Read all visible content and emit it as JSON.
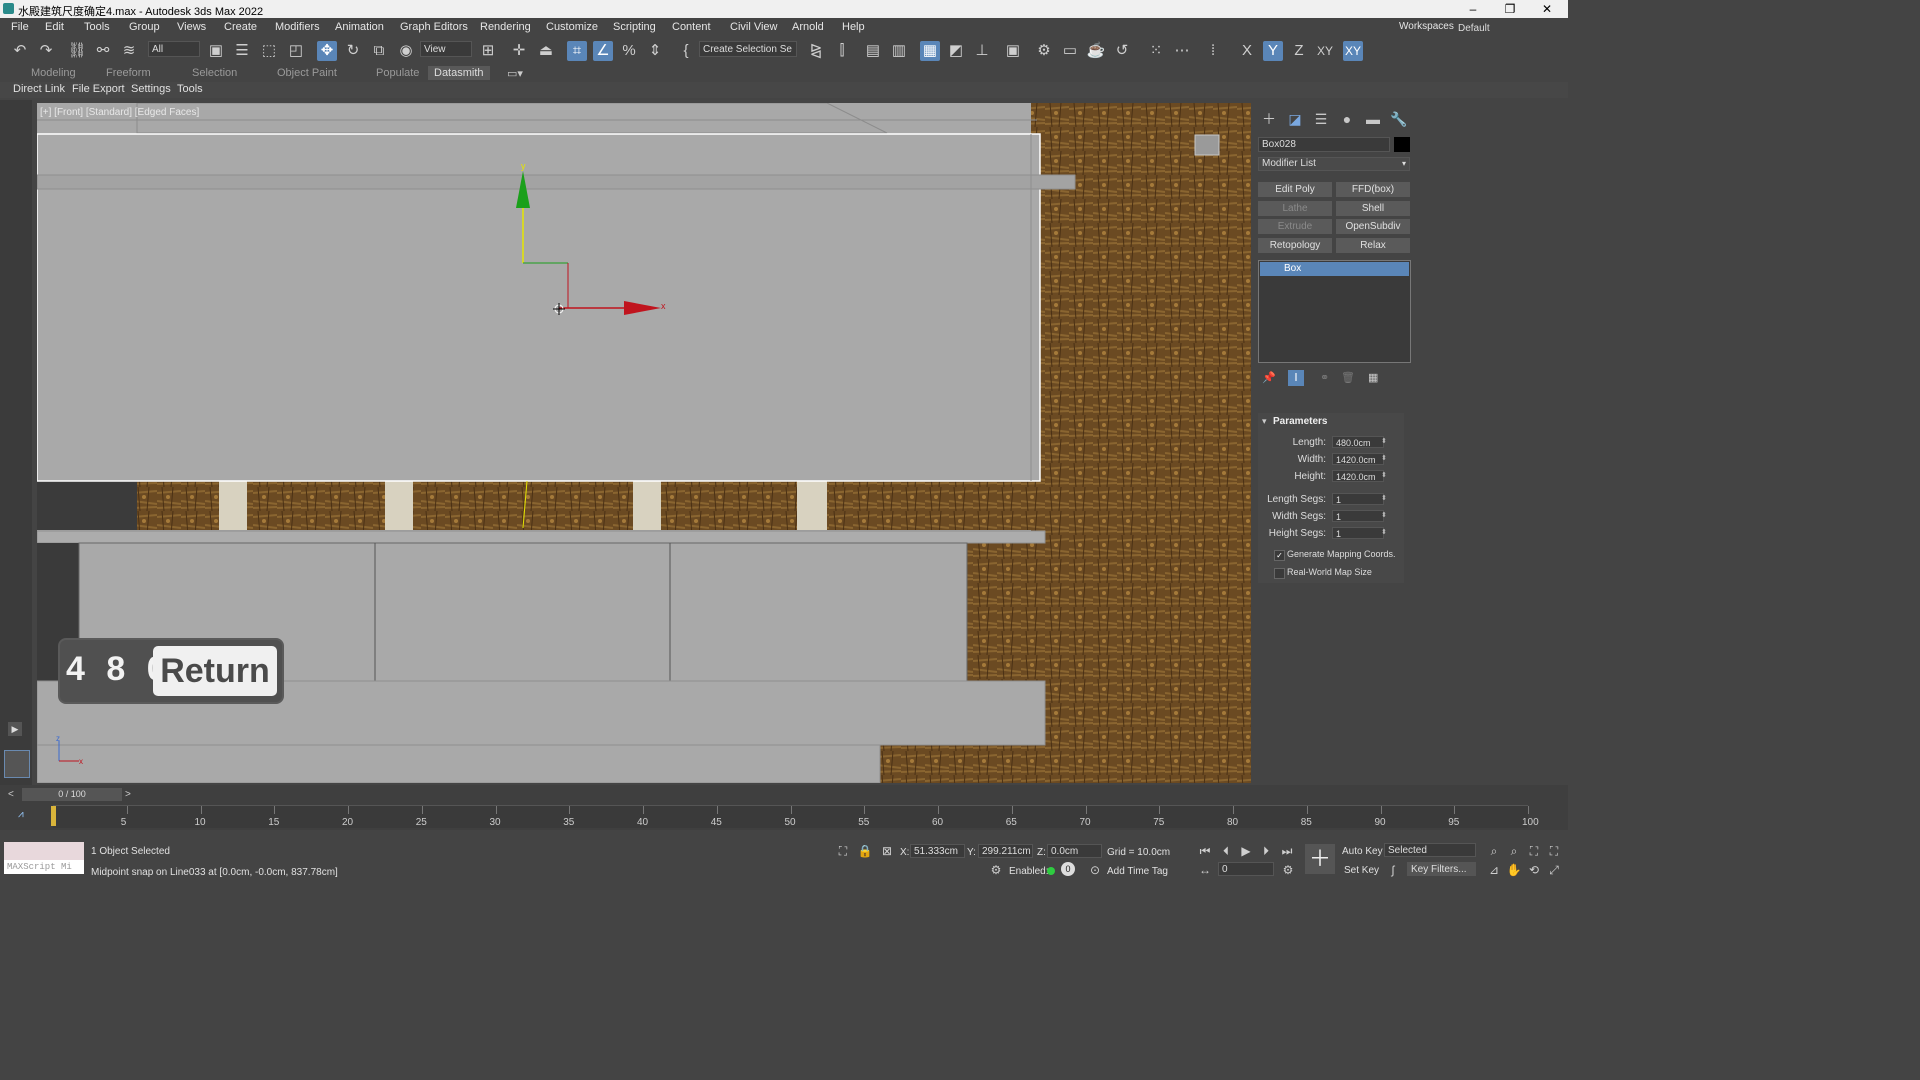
{
  "window": {
    "title": "水殿建筑尺度确定4.max - Autodesk 3ds Max 2022",
    "buttons": [
      "–",
      "❐",
      "✕"
    ]
  },
  "menu": [
    "File",
    "Edit",
    "Tools",
    "Group",
    "Views",
    "Create",
    "Modifiers",
    "Animation",
    "Graph Editors",
    "Rendering",
    "Customize",
    "Scripting",
    "Content",
    "Civil View",
    "Arnold",
    "Help"
  ],
  "workspaces": {
    "label": "Workspaces:",
    "value": "Default"
  },
  "toolbar": {
    "filter_value": "All",
    "view_value": "View",
    "selection_set_placeholder": "Create Selection Se",
    "axis_x": "X",
    "axis_y": "Y",
    "axis_z": "Z",
    "axis_xy": "XY",
    "axis_xy2": "XY"
  },
  "ribbon_tabs": [
    "Modeling",
    "Freeform",
    "Selection",
    "Object Paint",
    "Populate",
    "Datasmith"
  ],
  "ribbon_active": "Datasmith",
  "subbar": [
    "Direct Link",
    "File Export",
    "Settings",
    "Tools"
  ],
  "viewport": {
    "label": "[+] [Front] [Standard] [Edged Faces]",
    "gizmo_y": "y",
    "gizmo_x": "x",
    "axis_z": "z",
    "axis_x": "x"
  },
  "keycast": {
    "keys": "4 8 0",
    "return": "Return"
  },
  "command_panel": {
    "object_name": "Box028",
    "modifier_list": "Modifier List",
    "buttons": [
      {
        "label": "Edit Poly",
        "enabled": true
      },
      {
        "label": "FFD(box)",
        "enabled": true
      },
      {
        "label": "Lathe",
        "enabled": false
      },
      {
        "label": "Shell",
        "enabled": true
      },
      {
        "label": "Extrude",
        "enabled": false
      },
      {
        "label": "OpenSubdiv",
        "enabled": true
      },
      {
        "label": "Retopology",
        "enabled": true
      },
      {
        "label": "Relax",
        "enabled": true
      }
    ],
    "stack_item": "Box",
    "rollout_title": "Parameters",
    "params": [
      {
        "label": "Length:",
        "value": "480.0cm"
      },
      {
        "label": "Width:",
        "value": "1420.0cm"
      },
      {
        "label": "Height:",
        "value": "1420.0cm"
      },
      {
        "label": "Length Segs:",
        "value": "1"
      },
      {
        "label": "Width Segs:",
        "value": "1"
      },
      {
        "label": "Height Segs:",
        "value": "1"
      }
    ],
    "generate_mapping": "Generate Mapping Coords.",
    "real_world": "Real-World Map Size"
  },
  "timeline": {
    "frame_counter": "0 / 100",
    "ticks": [
      "5",
      "10",
      "15",
      "20",
      "25",
      "30",
      "35",
      "40",
      "45",
      "50",
      "55",
      "60",
      "65",
      "70",
      "75",
      "80",
      "85",
      "90",
      "95",
      "100"
    ]
  },
  "status": {
    "selected": "1 Object Selected",
    "prompt": "Midpoint snap on Line033 at [0.0cm, -0.0cm, 837.78cm]",
    "maxscript": "MAXScript Mi",
    "x_label": "X:",
    "x_value": "51.333cm",
    "y_label": "Y:",
    "y_value": "299.211cm",
    "z_label": "Z:",
    "z_value": "0.0cm",
    "grid": "Grid = 10.0cm",
    "enabled_label": "Enabled:",
    "add_time_tag": "Add Time Tag",
    "auto_key": "Auto Key",
    "set_key": "Set Key",
    "selected_value": "Selected",
    "key_filters": "Key Filters...",
    "frame_value": "0"
  },
  "colors": {
    "accent": "#5a86b8",
    "viewport_grey": "#a8a8a8",
    "gizmo_green": "#1aa01a",
    "gizmo_red": "#c0141e",
    "gizmo_yellow": "#e6e600",
    "painting_brown": "#6b4a22"
  }
}
